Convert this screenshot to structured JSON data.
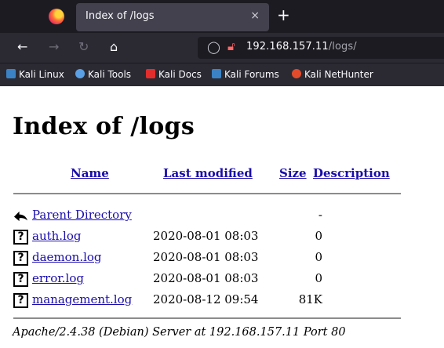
{
  "browser": {
    "tab_title": "Index of /logs",
    "tab_close": "×",
    "new_tab": "+",
    "nav": {
      "back": "←",
      "forward": "→",
      "reload": "↻",
      "home": "⌂"
    },
    "url_host": "192.168.157.11",
    "url_path": "/logs/",
    "bookmarks": [
      {
        "label": "Kali Linux",
        "color": "#3b82c4"
      },
      {
        "label": "Kali Tools",
        "color": "#5aa0e6"
      },
      {
        "label": "Kali Docs",
        "color": "#e22d2d"
      },
      {
        "label": "Kali Forums",
        "color": "#3b82c4"
      },
      {
        "label": "Kali NetHunter",
        "color": "#e44b2b"
      }
    ]
  },
  "page": {
    "title": "Index of /logs",
    "columns": {
      "name": "Name",
      "modified": "Last modified",
      "size": "Size",
      "description": "Description"
    },
    "rows": [
      {
        "icon": "back-arrow-icon",
        "name": "Parent Directory",
        "date": "",
        "size": "-"
      },
      {
        "icon": "unknown-file-icon",
        "name": "auth.log",
        "date": "2020-08-01 08:03",
        "size": "0"
      },
      {
        "icon": "unknown-file-icon",
        "name": "daemon.log",
        "date": "2020-08-01 08:03",
        "size": "0"
      },
      {
        "icon": "unknown-file-icon",
        "name": "error.log",
        "date": "2020-08-01 08:03",
        "size": "0"
      },
      {
        "icon": "unknown-file-icon",
        "name": "management.log",
        "date": "2020-08-12 09:54",
        "size": "81K"
      }
    ],
    "footer": "Apache/2.4.38 (Debian) Server at 192.168.157.11 Port 80"
  }
}
